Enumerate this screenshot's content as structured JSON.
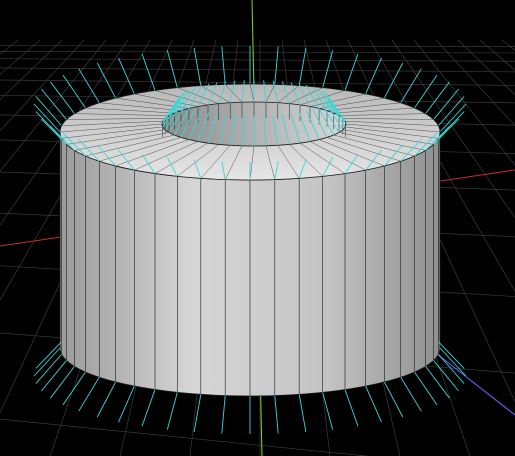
{
  "viewport": {
    "background": "#000000",
    "grid_color": "#3a3a3a",
    "axis_colors": {
      "x": "#c0303a",
      "y": "#7fd83a",
      "z": "#5a58e0"
    }
  },
  "mesh": {
    "shape": "hollow-cylinder",
    "segments": 48,
    "face_color": "#c9c9c9",
    "edge_color": "#1a1a1a",
    "normal_color": "#38d8d8",
    "normals_visible": true
  }
}
